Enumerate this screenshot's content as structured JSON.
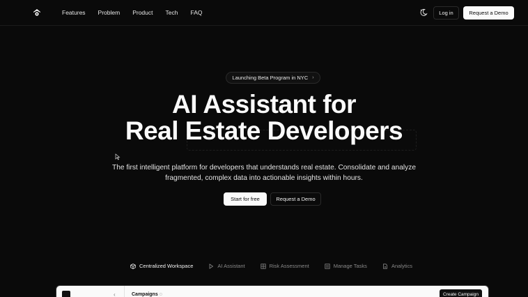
{
  "nav": {
    "links": [
      "Features",
      "Problem",
      "Product",
      "Tech",
      "FAQ"
    ],
    "login_label": "Log in",
    "demo_label": "Request a Demo"
  },
  "hero": {
    "badge": "Launching Beta Program in NYC",
    "badge_chevron": "›",
    "headline_line1": "AI Assistant for",
    "headline_line2": "Real Estate Developers",
    "subtitle": "The first intelligent platform for developers that understands real estate. Consolidate and analyze fragmented, complex data into actionable insights within hours.",
    "primary_cta": "Start for free",
    "secondary_cta": "Request a Demo"
  },
  "tabs": [
    {
      "label": "Centralized Workspace",
      "icon": "cube-icon"
    },
    {
      "label": "AI Assistant",
      "icon": "play-icon"
    },
    {
      "label": "Risk Assessment",
      "icon": "grid-icon"
    },
    {
      "label": "Manage Tasks",
      "icon": "checklist-icon"
    },
    {
      "label": "Analytics",
      "icon": "document-icon"
    }
  ],
  "preview": {
    "chevron": "‹",
    "title": "Campaigns",
    "title_suffix": "◌",
    "button_label": "Create Campaign"
  },
  "colors": {
    "background": "#0a0a0a",
    "foreground": "#fafafa",
    "muted": "#8a8a8a"
  }
}
